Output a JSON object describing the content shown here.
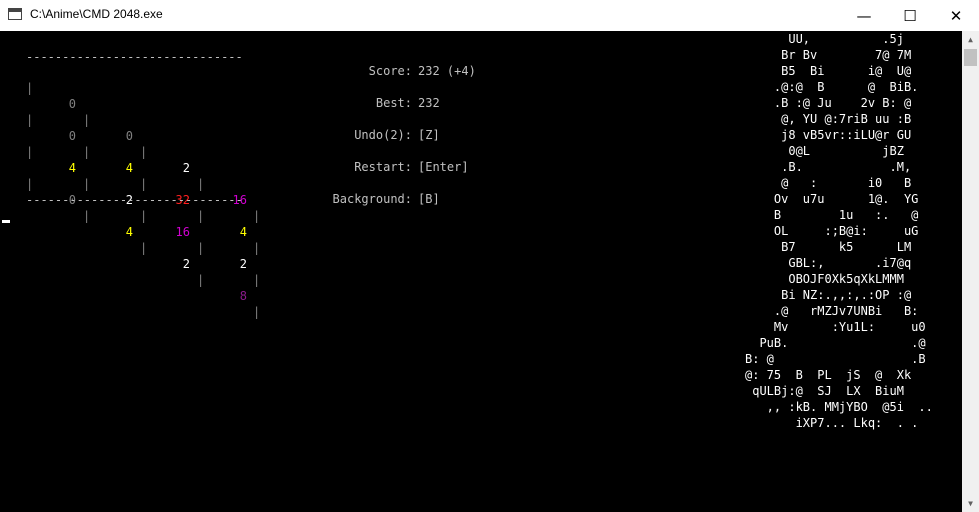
{
  "window": {
    "title": "C:\\Anime\\CMD 2048.exe"
  },
  "titlebar": {
    "minimize": "—",
    "maximize": "☐",
    "close": "✕"
  },
  "board": {
    "border": "------------------------------",
    "separator": "|",
    "rows": [
      [
        {
          "v": "0",
          "c": "#808080"
        },
        {
          "v": "0",
          "c": "#808080"
        },
        {
          "v": "2",
          "c": "#ffffff"
        },
        {
          "v": "16",
          "c": "#d000d0"
        }
      ],
      [
        {
          "v": "0",
          "c": "#808080"
        },
        {
          "v": "4",
          "c": "#ffff00"
        },
        {
          "v": "32",
          "c": "#ff2020"
        },
        {
          "v": "4",
          "c": "#ffff00"
        }
      ],
      [
        {
          "v": "4",
          "c": "#ffff00"
        },
        {
          "v": "2",
          "c": "#ffffff"
        },
        {
          "v": "16",
          "c": "#d000d0"
        },
        {
          "v": "2",
          "c": "#ffffff"
        }
      ],
      [
        {
          "v": "0",
          "c": "#808080"
        },
        {
          "v": "4",
          "c": "#ffff00"
        },
        {
          "v": "2",
          "c": "#ffffff"
        },
        {
          "v": "8",
          "c": "#8a1a8a"
        }
      ]
    ]
  },
  "info": {
    "score_label": "Score:",
    "score_value": "232 (+4)",
    "best_label": "Best:",
    "best_value": "232",
    "undo_label": "Undo(2):",
    "undo_value": "[Z]",
    "restart_label": "Restart:",
    "restart_value": "[Enter]",
    "background_label": "Background:",
    "background_value": "[B]"
  },
  "ascii_art": "      UU,          .5j\n     Br Bv        7@ 7M\n     B5  Bi      i@  U@\n    .@:@  B      @  BiB.\n    .B :@ Ju    2v B: @\n     @, YU @:7riB uu :B\n     j8 vB5vr::iLU@r GU\n      0@L          jBZ\n     .B.            .M,\n     @   :       i0   B\n    Ov  u7u      1@.  YG\n    B        1u   :.   @\n    OL     :;B@i:     uG\n     B7      k5      LM\n      GBL:,       .i7@q\n      OBOJF0Xk5qXkLMMM\n     Bi NZ:.,,:,.:OP :@\n    .@   rMZJv7UNBi   B:\n    Mv      :Yu1L:     u0\n  PuB.                 .@\nB: @                   .B\n@: 75  B  PL  jS  @  Xk\n qULBj:@  SJ  LX  BiuM\n   ,, :kB. MMjYBO  @5i  ..\n       iXP7... Lkq:  . ."
}
